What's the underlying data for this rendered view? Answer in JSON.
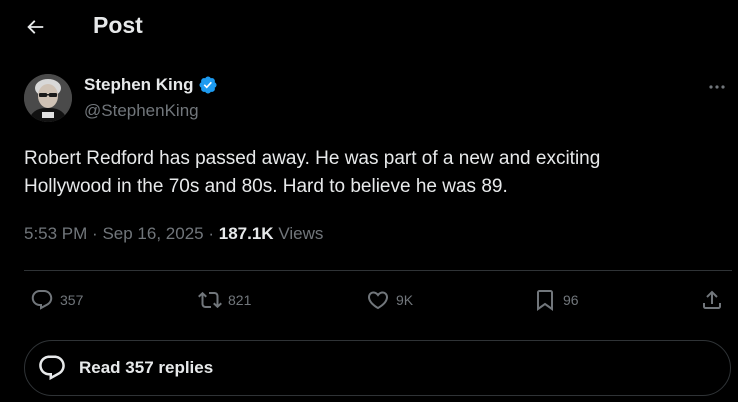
{
  "header": {
    "title": "Post"
  },
  "author": {
    "name": "Stephen King",
    "handle": "@StephenKing"
  },
  "post": {
    "text_lines": [
      "Robert Redford has passed away. He was part of a new and exciting",
      "Hollywood in the 70s and 80s. Hard to believe he was 89."
    ],
    "time": "5:53 PM",
    "date": "Sep 16, 2025",
    "separator": "·",
    "views_count": "187.1K",
    "views_label": "Views"
  },
  "actions": {
    "replies": "357",
    "reposts": "821",
    "likes": "9K",
    "bookmarks": "96"
  },
  "read_replies": {
    "label": "Read 357 replies"
  },
  "colors": {
    "background": "#000000",
    "text": "#e7e9ea",
    "muted": "#71767b",
    "verified": "#1d9bf0",
    "border": "#2f3336"
  }
}
